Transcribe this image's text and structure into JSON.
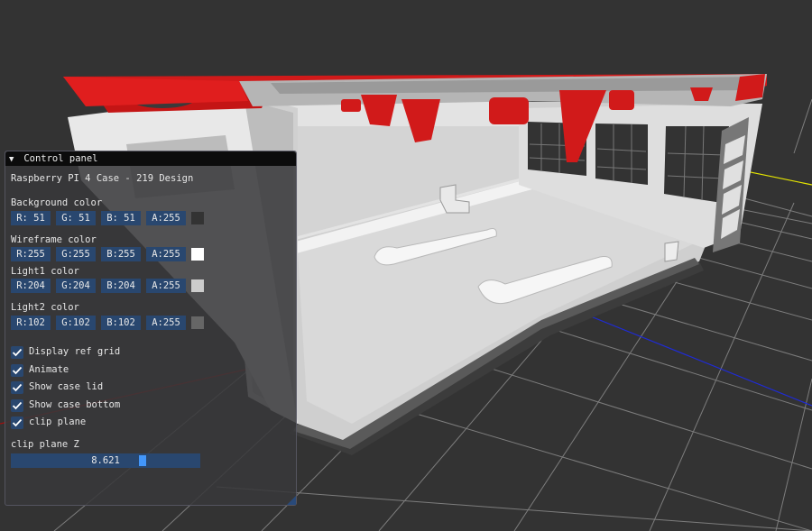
{
  "panel": {
    "title": "Control panel",
    "collapse_glyph": "▼",
    "subtitle": "Raspberry PI 4 Case - 219 Design",
    "colors": [
      {
        "label": "Background color",
        "r": "R: 51",
        "g": "G: 51",
        "b": "B: 51",
        "a": "A:255",
        "swatch": "#333333"
      },
      {
        "label": "Wireframe color",
        "r": "R:255",
        "g": "G:255",
        "b": "B:255",
        "a": "A:255",
        "swatch": "#ffffff"
      },
      {
        "label": "Light1 color",
        "r": "R:204",
        "g": "G:204",
        "b": "B:204",
        "a": "A:255",
        "swatch": "#cccccc"
      },
      {
        "label": "Light2 color",
        "r": "R:102",
        "g": "G:102",
        "b": "B:102",
        "a": "A:255",
        "swatch": "#666666"
      }
    ],
    "checkboxes": [
      {
        "label": "Display ref grid",
        "checked": true
      },
      {
        "label": "Animate",
        "checked": true
      },
      {
        "label": "Show case lid",
        "checked": true
      },
      {
        "label": "Show case bottom",
        "checked": true
      },
      {
        "label": "clip plane",
        "checked": true
      }
    ],
    "slider": {
      "label": "clip plane Z",
      "value": "8.621",
      "fraction": 0.705
    }
  },
  "scene": {
    "background": "#333333",
    "grid_color": "#8a8a8a",
    "axis_x_color": "#ff0000",
    "axis_y_color": "#e6e600",
    "axis_z_color": "#1f2bd6",
    "lid_color": "#d11a1a",
    "case_color": "#e6e6e6"
  }
}
